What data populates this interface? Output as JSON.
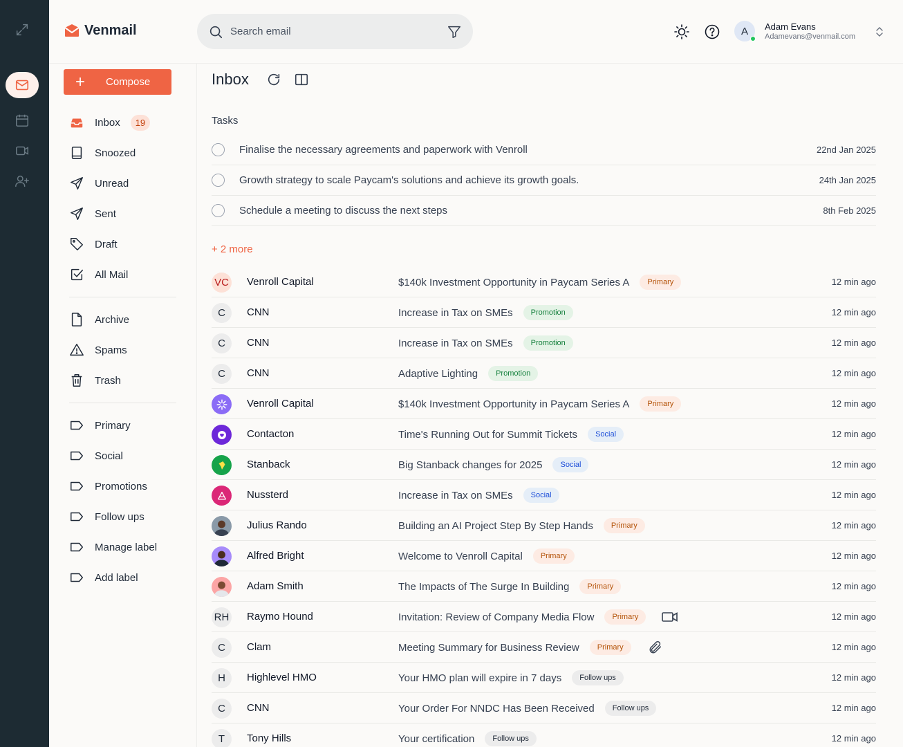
{
  "app": {
    "name": "Venmail",
    "brand_color": "#ef6444"
  },
  "search": {
    "placeholder": "Search email"
  },
  "user": {
    "initial": "A",
    "name": "Adam Evans",
    "email": "Adamevans@venmail.com"
  },
  "rail": {
    "icons": [
      "expand-icon",
      "mail-icon",
      "calendar-icon",
      "video-icon",
      "add-user-icon"
    ]
  },
  "sidebar": {
    "compose_label": "Compose",
    "items": [
      {
        "label": "Inbox",
        "icon": "inbox-icon",
        "count": "19"
      },
      {
        "label": "Snoozed",
        "icon": "snooze-icon"
      },
      {
        "label": "Unread",
        "icon": "send-icon"
      },
      {
        "label": "Sent",
        "icon": "send-icon"
      },
      {
        "label": "Draft",
        "icon": "tag-icon"
      },
      {
        "label": "All Mail",
        "icon": "check-square-icon"
      }
    ],
    "items2": [
      {
        "label": "Archive",
        "icon": "file-icon"
      },
      {
        "label": "Spams",
        "icon": "warning-icon"
      },
      {
        "label": "Trash",
        "icon": "trash-icon"
      }
    ],
    "labels": [
      {
        "label": "Primary"
      },
      {
        "label": "Social"
      },
      {
        "label": "Promotions"
      },
      {
        "label": "Follow ups"
      },
      {
        "label": "Manage label"
      },
      {
        "label": "Add label"
      }
    ]
  },
  "main": {
    "title": "Inbox",
    "tasks_title": "Tasks",
    "tasks": [
      {
        "text": "Finalise the necessary agreements and paperwork with Venroll",
        "date": "22nd Jan 2025"
      },
      {
        "text": "Growth strategy to scale Paycam's solutions and achieve its growth goals.",
        "date": "24th Jan 2025"
      },
      {
        "text": "Schedule a meeting to discuss the next steps",
        "date": "8th Feb 2025"
      }
    ],
    "more": "+ 2 more",
    "emails": [
      {
        "avatar": "VC",
        "sender": "Venroll Capital",
        "subject": "$140k Investment Opportunity in Paycam Series A",
        "tag": "Primary",
        "time": "12 min ago"
      },
      {
        "avatar": "C",
        "sender": "CNN",
        "subject": "Increase in Tax on SMEs",
        "tag": "Promotion",
        "time": "12 min ago"
      },
      {
        "avatar": "C",
        "sender": "CNN",
        "subject": "Increase in Tax on SMEs",
        "tag": "Promotion",
        "time": "12 min ago"
      },
      {
        "avatar": "C",
        "sender": "CNN",
        "subject": "Adaptive Lighting",
        "tag": "Promotion",
        "time": "12 min ago"
      },
      {
        "avatar": "",
        "sender": "Venroll Capital",
        "subject": "$140k Investment Opportunity in Paycam Series A",
        "tag": "Primary",
        "time": "12 min ago"
      },
      {
        "avatar": "",
        "sender": "Contacton",
        "subject": "Time's Running Out for Summit Tickets",
        "tag": "Social",
        "time": "12 min ago"
      },
      {
        "avatar": "",
        "sender": "Stanback",
        "subject": "Big Stanback changes for 2025",
        "tag": "Social",
        "time": "12 min ago"
      },
      {
        "avatar": "",
        "sender": "Nussterd",
        "subject": "Increase in Tax on SMEs",
        "tag": "Social",
        "time": "12 min ago"
      },
      {
        "avatar": "",
        "sender": "Julius Rando",
        "subject": "Building an AI Project Step By Step Hands",
        "tag": "Primary",
        "time": "12 min ago"
      },
      {
        "avatar": "",
        "sender": "Alfred Bright",
        "subject": "Welcome to Venroll Capital",
        "tag": "Primary",
        "time": "12 min ago"
      },
      {
        "avatar": "",
        "sender": "Adam Smith",
        "subject": "The Impacts of The Surge In Building",
        "tag": "Primary",
        "time": "12 min ago"
      },
      {
        "avatar": "RH",
        "sender": "Raymo Hound",
        "subject": "Invitation: Review of Company Media Flow",
        "tag": "Primary",
        "time": "12 min ago",
        "extra_icon": "video-icon"
      },
      {
        "avatar": "C",
        "sender": "Clam",
        "subject": "Meeting Summary for Business Review",
        "tag": "Primary",
        "time": "12 min ago",
        "extra_icon": "attachment-icon"
      },
      {
        "avatar": "H",
        "sender": "Highlevel HMO",
        "subject": "Your HMO plan will expire in 7 days",
        "tag": "Follow ups",
        "time": "12 min ago"
      },
      {
        "avatar": "C",
        "sender": "CNN",
        "subject": "Your Order For NNDC Has Been Received",
        "tag": "Follow ups",
        "time": "12 min ago"
      },
      {
        "avatar": "T",
        "sender": "Tony Hills",
        "subject": "Your certification",
        "tag": "Follow ups",
        "time": "12 min ago"
      }
    ]
  }
}
